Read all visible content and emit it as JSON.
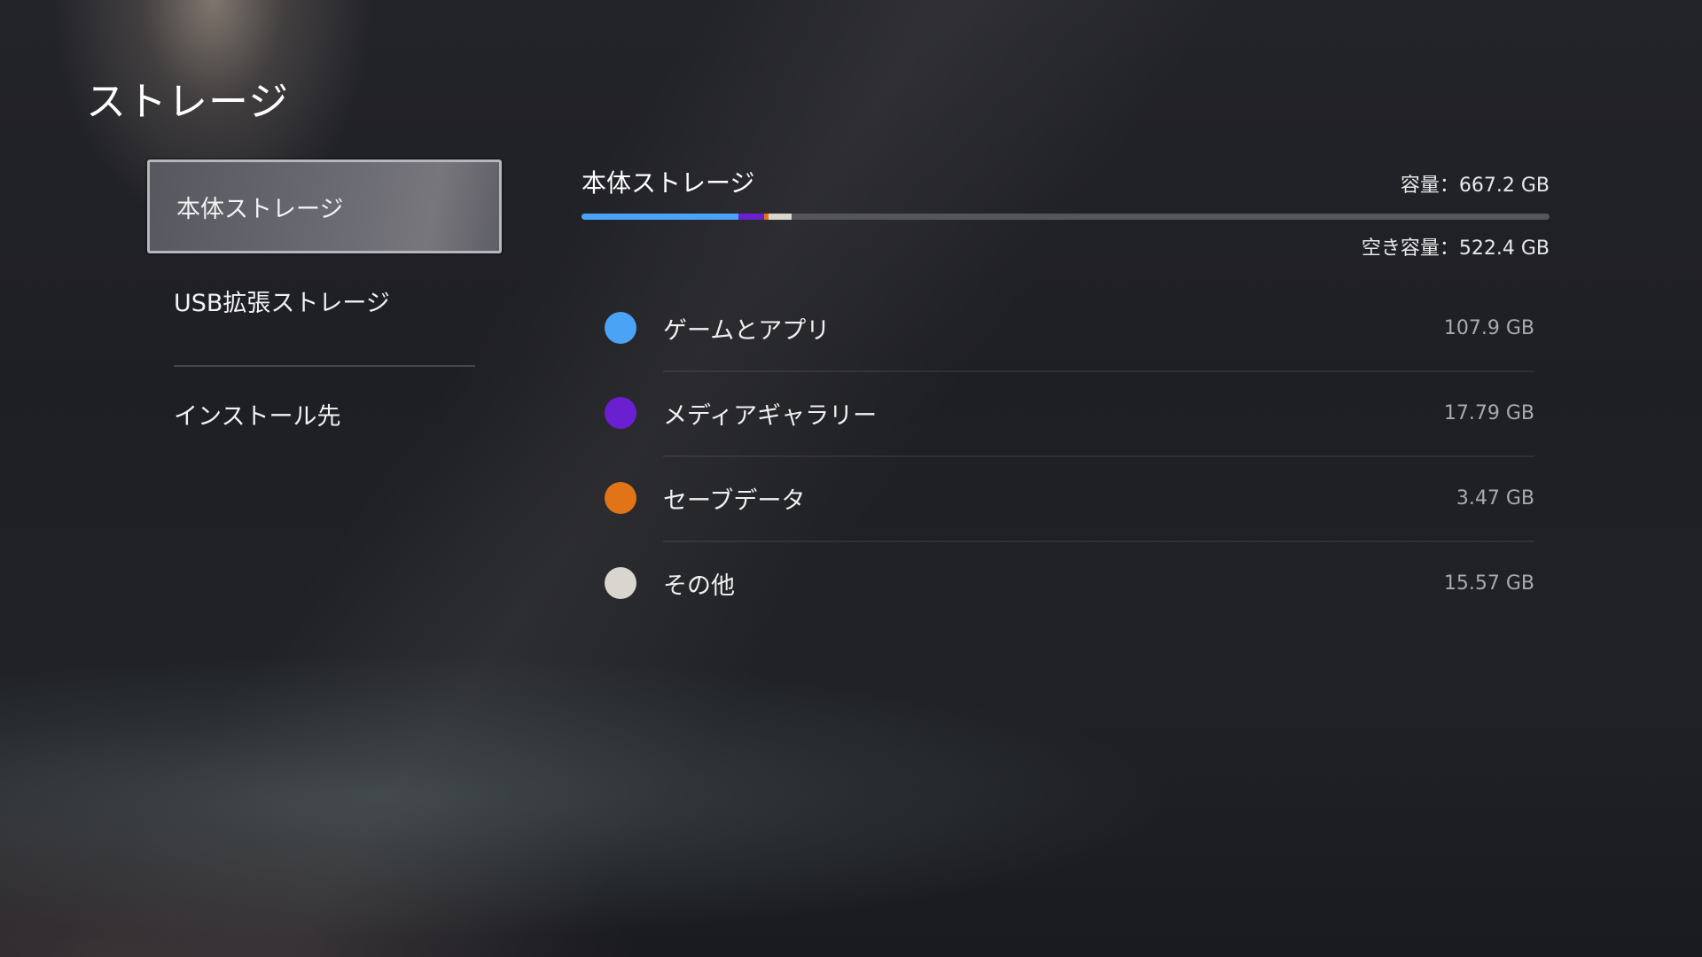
{
  "page": {
    "title": "ストレージ"
  },
  "nav": {
    "items": [
      {
        "label": "本体ストレージ",
        "selected": true
      },
      {
        "label": "USB拡張ストレージ",
        "selected": false
      },
      {
        "label": "インストール先",
        "selected": false
      }
    ]
  },
  "storage": {
    "title": "本体ストレージ",
    "capacity": "容量：667.2 GB",
    "free": "空き容量：522.4 GB",
    "bar_background_color": "#55565b",
    "categories": [
      {
        "label": "ゲームとアプリ",
        "size": "107.9 GB",
        "size_gb": 107.9,
        "color": "#4aa3f5"
      },
      {
        "label": "メディアギャラリー",
        "size": "17.79 GB",
        "size_gb": 17.79,
        "color": "#6a1fd0"
      },
      {
        "label": "セーブデータ",
        "size": "3.47 GB",
        "size_gb": 3.47,
        "color": "#e07416"
      },
      {
        "label": "その他",
        "size": "15.57 GB",
        "size_gb": 15.57,
        "color": "#d9d5cf"
      }
    ],
    "total_gb": 667.2
  }
}
